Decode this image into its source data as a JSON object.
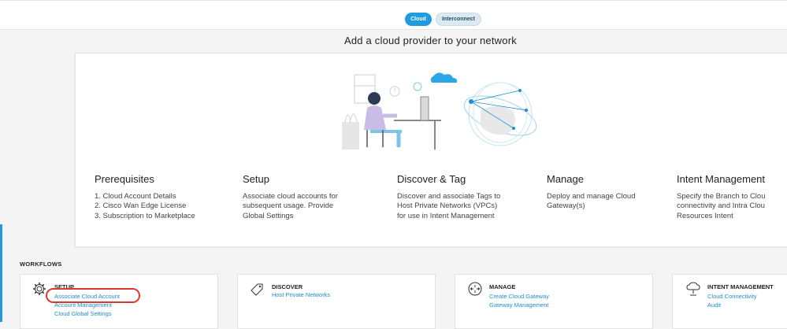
{
  "toggle": {
    "cloud": "Cloud",
    "interconnect": "Interconnect"
  },
  "page_title": "Add a cloud provider to your network",
  "steps": [
    {
      "heading": "Prerequisites",
      "text": "1. Cloud Account Details\n2. Cisco Wan Edge License\n3. Subscription to Marketplace"
    },
    {
      "heading": "Setup",
      "text": "Associate cloud accounts for\nsubsequent usage. Provide\nGlobal Settings"
    },
    {
      "heading": "Discover & Tag",
      "text": "Discover and associate Tags to\nHost Private Networks (VPCs)\nfor use in Intent Management"
    },
    {
      "heading": "Manage",
      "text": "Deploy and manage Cloud\nGateway(s)"
    },
    {
      "heading": "Intent Management",
      "text": "Specify the Branch to Clou\nconnectivity and Intra Clou\nResources Intent"
    }
  ],
  "workflows_label": "WORKFLOWS",
  "cards": [
    {
      "title": "SETUP",
      "icon": "gear-icon",
      "links": [
        "Associate Cloud Account",
        "Account Management",
        "Cloud Global Settings"
      ]
    },
    {
      "title": "DISCOVER",
      "icon": "tag-icon",
      "links": [
        "Host Private Networks"
      ]
    },
    {
      "title": "MANAGE",
      "icon": "gateway-icon",
      "links": [
        "Create Cloud Gateway",
        "Gateway Management"
      ]
    },
    {
      "title": "INTENT MANAGEMENT",
      "icon": "cloud-connectivity-icon",
      "links": [
        "Cloud Connectivity",
        "Audit"
      ]
    }
  ],
  "colors": {
    "accent": "#1f9bde",
    "link": "#1f8ed3",
    "highlight": "#d93a2e"
  }
}
